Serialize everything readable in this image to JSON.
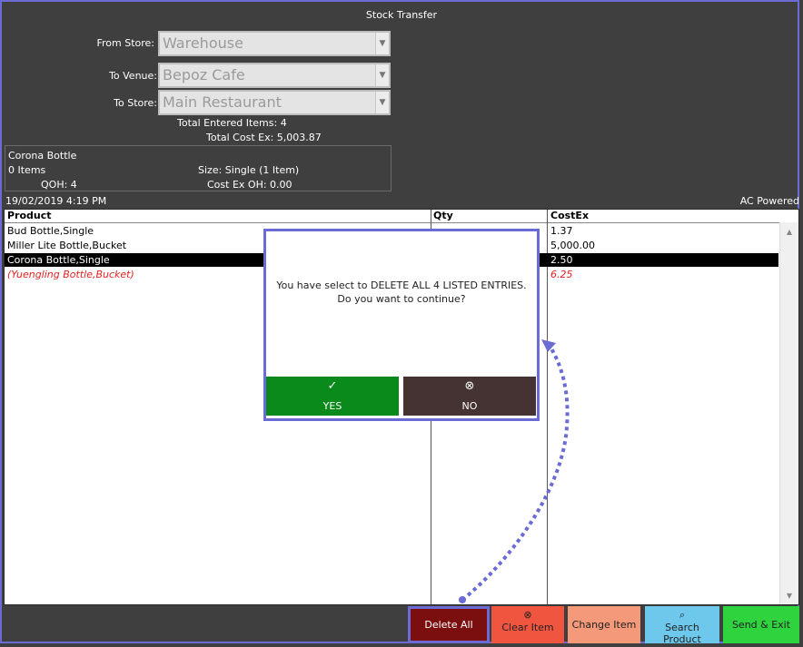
{
  "window": {
    "title": "Stock Transfer"
  },
  "form": {
    "from_store_label": "From Store:",
    "from_store_value": "Warehouse",
    "to_venue_label": "To Venue:",
    "to_venue_value": "Bepoz Cafe",
    "to_store_label": "To Store:",
    "to_store_value": "Main Restaurant"
  },
  "summary": {
    "total_entered": "Total Entered Items: 4",
    "total_cost": "Total Cost Ex: 5,003.87"
  },
  "info": {
    "product_name": "Corona Bottle",
    "items": "0 Items",
    "size": "Size: Single (1 Item)",
    "qoh": "QOH:  4",
    "cost_oh": "Cost Ex OH: 0.00"
  },
  "status": {
    "datetime": "19/02/2019 4:19 PM",
    "power": "AC Powered"
  },
  "table": {
    "headers": [
      "Product",
      "Qty",
      "CostEx"
    ],
    "rows": [
      {
        "product": "Bud Bottle,Single",
        "qty": "",
        "cost": "1.37"
      },
      {
        "product": "Miller Lite Bottle,Bucket",
        "qty": "",
        "cost": "5,000.00"
      },
      {
        "product": "Corona Bottle,Single",
        "qty": "",
        "cost": "2.50"
      },
      {
        "product": "(Yuengling Bottle,Bucket)",
        "qty": "",
        "cost": "6.25"
      }
    ]
  },
  "dialog": {
    "message_line1": "You have select to DELETE ALL 4 LISTED ENTRIES.",
    "message_line2": "Do you want to continue?",
    "yes_label": "YES",
    "no_label": "NO"
  },
  "buttons": {
    "delete_all": "Delete All",
    "clear_item": "Clear Item",
    "change_item": "Change Item",
    "search_product": "Search Product",
    "send_exit": "Send & Exit"
  },
  "icons": {
    "check": "check-icon",
    "close": "close-circle-icon",
    "search": "search-icon"
  },
  "colors": {
    "accent_border": "#6b6bd6",
    "yes_green": "#0a8a1a",
    "no_brown": "#453232",
    "delete_red": "#7b0f0f",
    "clear_red": "#f05540",
    "change_salmon": "#f49a7a",
    "search_blue": "#6ec8ec",
    "send_green": "#2ed33e"
  }
}
